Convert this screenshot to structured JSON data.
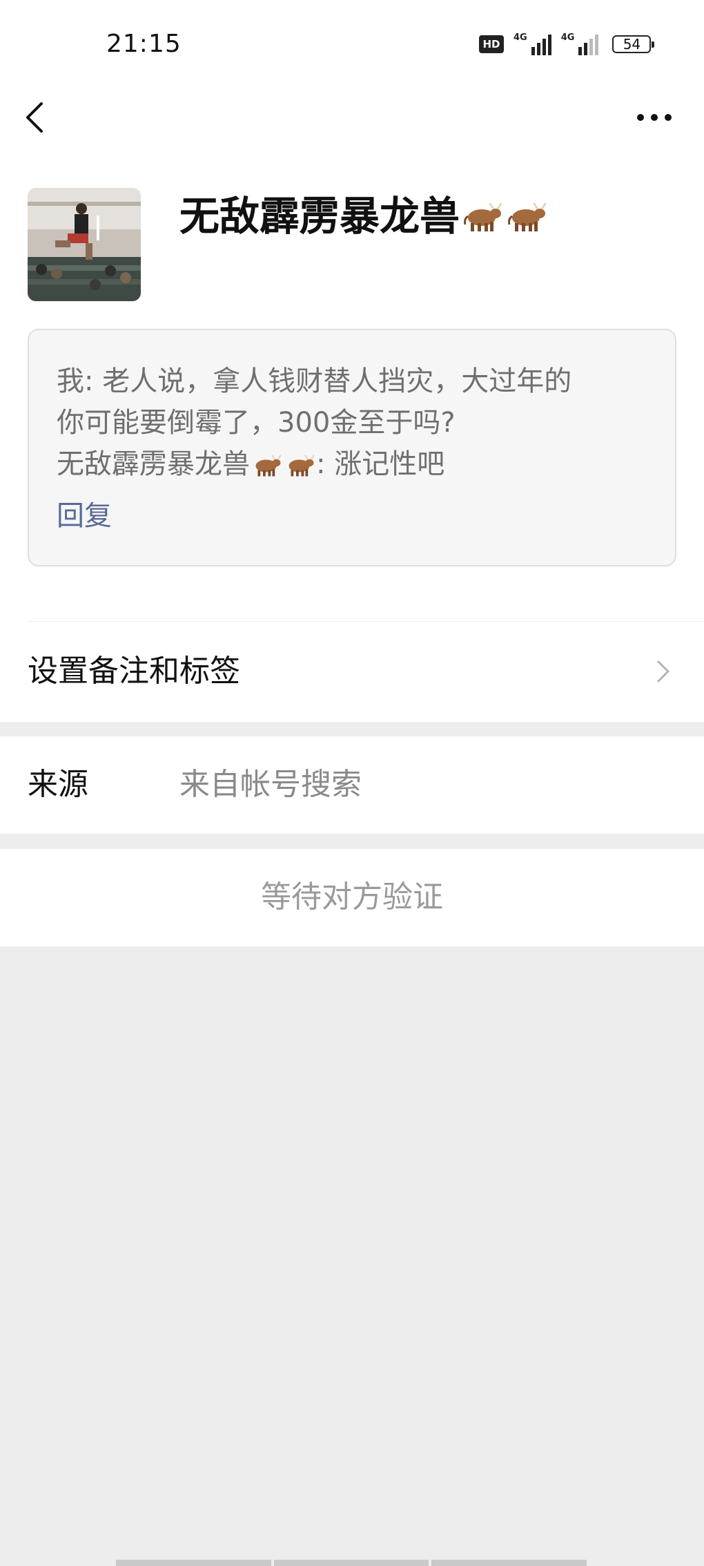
{
  "status_bar": {
    "time": "21:15",
    "hd_label": "HD",
    "network_1": "4G",
    "network_2": "4G",
    "battery_level": "54"
  },
  "nav": {
    "back_icon": "chevron-left-icon",
    "more_icon": "more-dots-icon"
  },
  "profile": {
    "avatar_icon": "avatar-photo",
    "name": "无敌霹雳暴龙兽",
    "name_emoji": "ox-emoji"
  },
  "request_message": {
    "line1": "我: 老人说，拿人钱财替人挡灾，大过年的",
    "line2": "你可能要倒霉了，300金至于吗?",
    "line3_name": "无敌霹雳暴龙兽",
    "line3_text": ": 涨记性吧",
    "reply_label": "回复"
  },
  "remark_row": {
    "label": "设置备注和标签",
    "icon": "chevron-right-icon"
  },
  "source_row": {
    "label": "来源",
    "value": "来自帐号搜索"
  },
  "status_row": {
    "text": "等待对方验证"
  },
  "colors": {
    "link": "#576b95",
    "background": "#ededed",
    "card_bg": "#f6f6f7",
    "muted_text": "#9a9a9a"
  }
}
